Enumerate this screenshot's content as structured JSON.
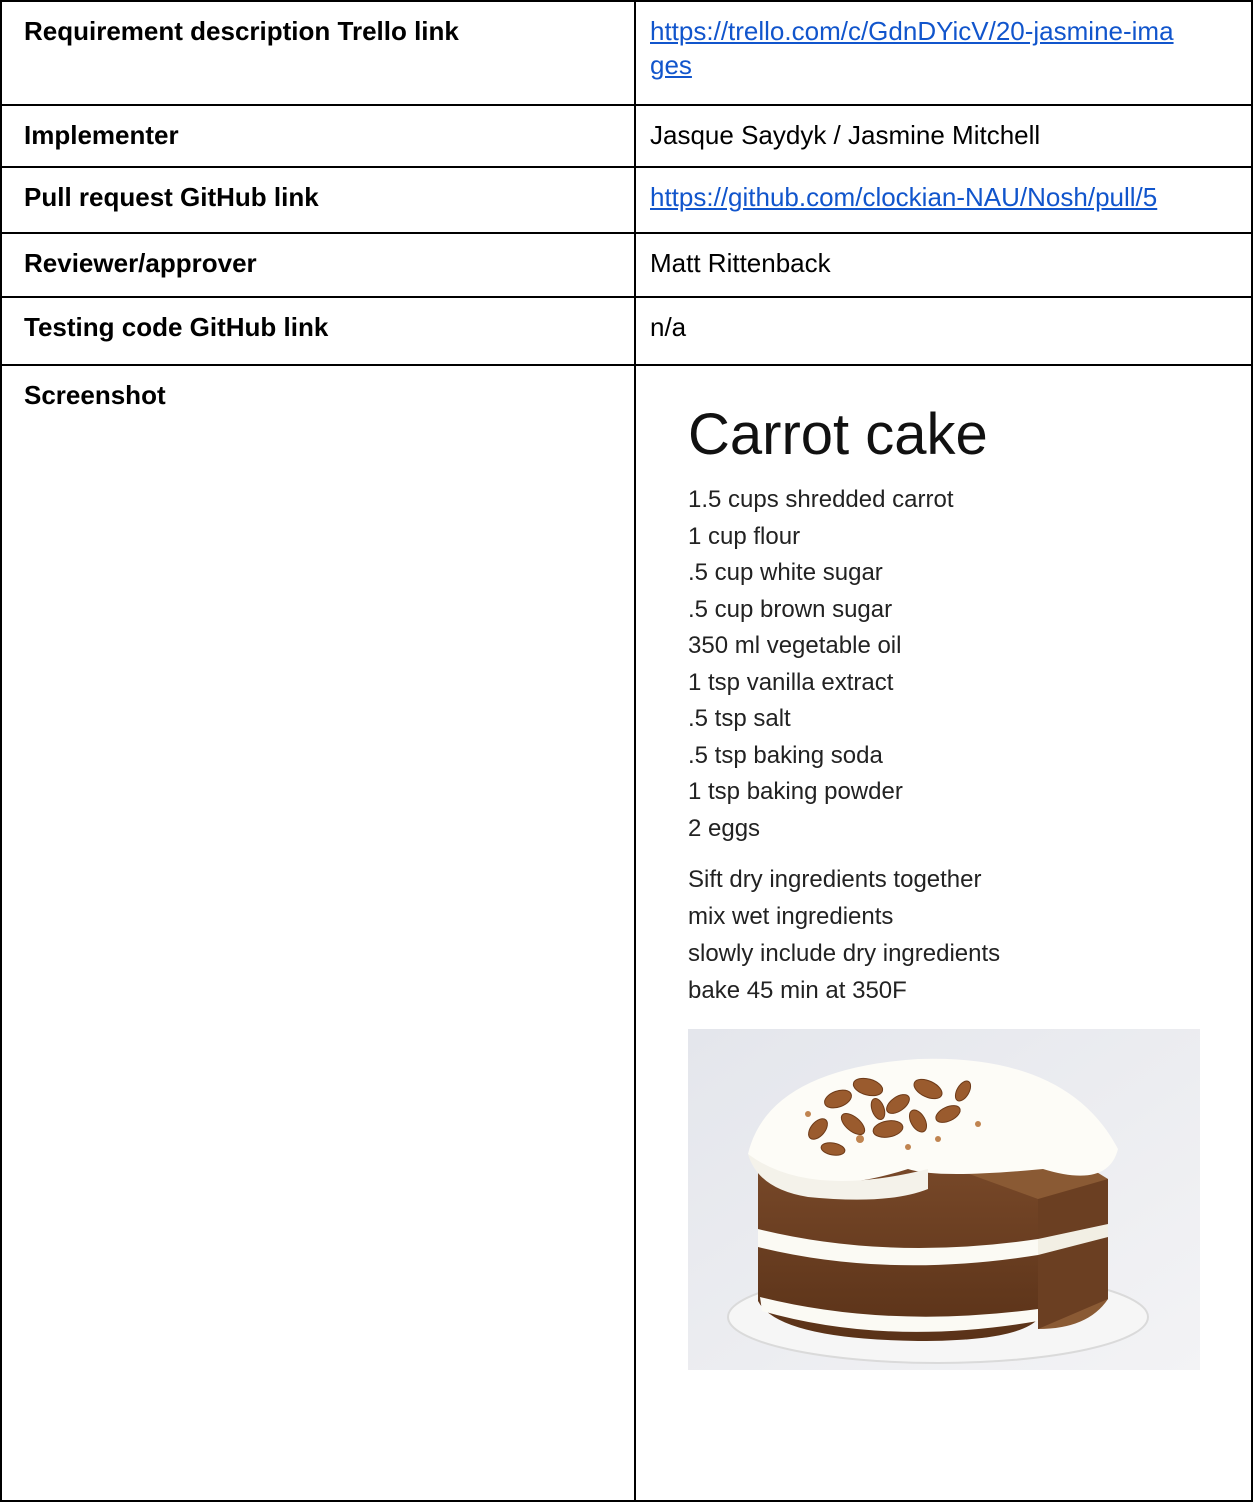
{
  "rows": [
    {
      "label": "Requirement description Trello link",
      "value": "https://trello.com/c/GdnDYicV/20-jasmine-images",
      "value_line1": "https://trello.com/c/GdnDYicV/20-jasmine-ima",
      "value_line2": "ges"
    },
    {
      "label": "Implementer",
      "value": "Jasque Saydyk / Jasmine Mitchell"
    },
    {
      "label": "Pull request GitHub link",
      "value": "https://github.com/clockian-NAU/Nosh/pull/5"
    },
    {
      "label": "Reviewer/approver",
      "value": "Matt Rittenback"
    },
    {
      "label": "Testing code GitHub link",
      "value": "n/a"
    },
    {
      "label": "Screenshot"
    }
  ],
  "screenshot": {
    "title": "Carrot cake",
    "ingredients": [
      "1.5 cups shredded carrot",
      "1 cup flour",
      ".5 cup white sugar",
      ".5 cup brown sugar",
      "350 ml vegetable oil",
      "1 tsp vanilla extract",
      ".5 tsp salt",
      ".5 tsp baking soda",
      "1 tsp baking powder",
      "2 eggs"
    ],
    "steps": [
      "Sift dry ingredients together",
      "mix wet ingredients",
      "slowly include dry ingredients",
      "bake 45 min at 350F"
    ]
  },
  "colors": {
    "link": "#1155cc",
    "border": "#000000"
  }
}
